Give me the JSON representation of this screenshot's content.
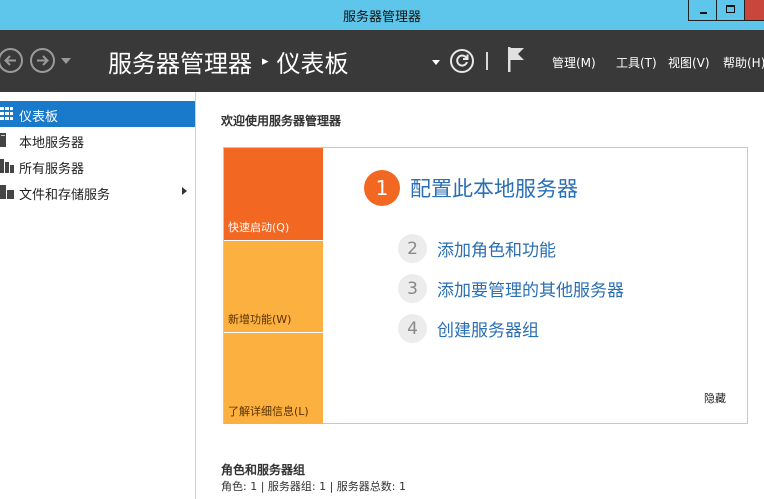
{
  "window": {
    "title": "服务器管理器"
  },
  "header": {
    "breadcrumb_root": "服务器管理器",
    "breadcrumb_separator": "▸",
    "breadcrumb_current": "仪表板",
    "menus": [
      "管理(M)",
      "工具(T)",
      "视图(V)",
      "帮助(H)"
    ]
  },
  "sidebar": {
    "items": [
      {
        "label": "仪表板",
        "icon": "dashboard-icon",
        "active": true
      },
      {
        "label": "本地服务器",
        "icon": "server-icon"
      },
      {
        "label": "所有服务器",
        "icon": "servers-icon"
      },
      {
        "label": "文件和存储服务",
        "icon": "storage-icon",
        "has_submenu": true
      }
    ]
  },
  "main": {
    "welcome_title": "欢迎使用服务器管理器",
    "tiles": [
      "快速启动(Q)",
      "新增功能(W)",
      "了解详细信息(L)"
    ],
    "steps": [
      {
        "number": "1",
        "label": "配置此本地服务器"
      },
      {
        "number": "2",
        "label": "添加角色和功能"
      },
      {
        "number": "3",
        "label": "添加要管理的其他服务器"
      },
      {
        "number": "4",
        "label": "创建服务器组"
      }
    ],
    "hide_label": "隐藏",
    "roles_title": "角色和服务器组",
    "roles_summary": "角色: 1 | 服务器组: 1 | 服务器总数: 1"
  },
  "colors": {
    "titlebar": "#5ec6ea",
    "header": "#393939",
    "accent_orange": "#f26722",
    "tile_yellow": "#fbb040",
    "selection_blue": "#1979ca",
    "link_blue": "#2a6fb3"
  }
}
